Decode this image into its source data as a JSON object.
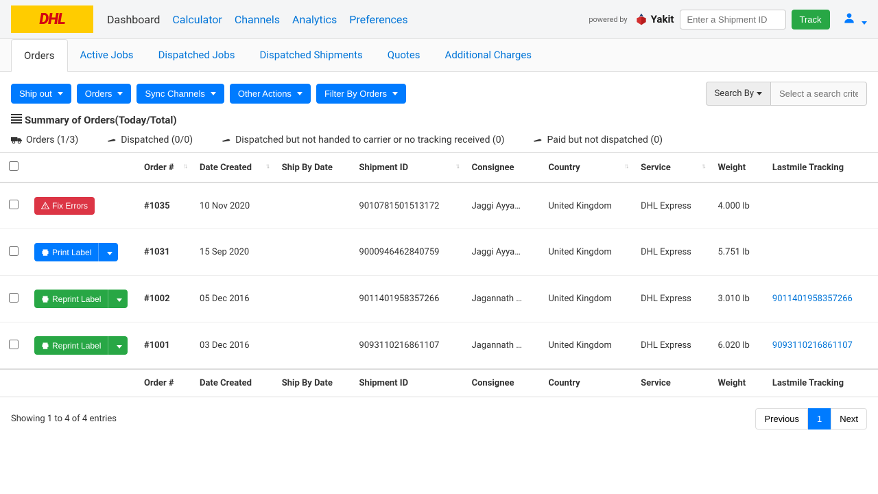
{
  "brand": "DHL",
  "nav": {
    "dashboard": "Dashboard",
    "calculator": "Calculator",
    "channels": "Channels",
    "analytics": "Analytics",
    "preferences": "Preferences"
  },
  "powered_by": "powered by",
  "partner": "Yakit",
  "shipment_input_placeholder": "Enter a Shipment ID",
  "track_btn": "Track",
  "tabs": {
    "orders": "Orders",
    "active_jobs": "Active Jobs",
    "dispatched_jobs": "Dispatched Jobs",
    "dispatched_shipments": "Dispatched Shipments",
    "quotes": "Quotes",
    "additional_charges": "Additional Charges"
  },
  "toolbar": {
    "ship_out": "Ship out",
    "orders": "Orders",
    "sync_channels": "Sync Channels",
    "other_actions": "Other Actions",
    "filter_by_orders": "Filter By Orders",
    "search_by": "Search By",
    "search_placeholder": "Select a search criteria"
  },
  "summary": {
    "title": "Summary of Orders(Today/Total)",
    "orders": "Orders (1/3)",
    "dispatched": "Dispatched (0/0)",
    "not_handed": "Dispatched but not handed to carrier or no tracking received (0)",
    "paid_not_dispatched": "Paid but not dispatched (0)"
  },
  "columns": {
    "order_no": "Order #",
    "date_created": "Date Created",
    "ship_by": "Ship By Date",
    "shipment_id": "Shipment ID",
    "consignee": "Consignee",
    "country": "Country",
    "service": "Service",
    "weight": "Weight",
    "lastmile": "Lastmile Tracking"
  },
  "actions": {
    "fix_errors": "Fix Errors",
    "print_label": "Print Label",
    "reprint_label": "Reprint Label"
  },
  "rows": [
    {
      "order": "#1035",
      "date": "10 Nov 2020",
      "shipby": "",
      "shipment": "9010781501513172",
      "consignee": "Jaggi Ayya…",
      "country": "United Kingdom",
      "service": "DHL Express",
      "weight": "4.000 lb",
      "tracking": ""
    },
    {
      "order": "#1031",
      "date": "15 Sep 2020",
      "shipby": "",
      "shipment": "9000946462840759",
      "consignee": "Jaggi Ayya…",
      "country": "United Kingdom",
      "service": "DHL Express",
      "weight": "5.751 lb",
      "tracking": ""
    },
    {
      "order": "#1002",
      "date": "05 Dec 2016",
      "shipby": "",
      "shipment": "9011401958357266",
      "consignee": "Jagannath …",
      "country": "United Kingdom",
      "service": "DHL Express",
      "weight": "3.010 lb",
      "tracking": "9011401958357266"
    },
    {
      "order": "#1001",
      "date": "03 Dec 2016",
      "shipby": "",
      "shipment": "9093110216861107",
      "consignee": "Jagannath …",
      "country": "United Kingdom",
      "service": "DHL Express",
      "weight": "6.020 lb",
      "tracking": "9093110216861107"
    }
  ],
  "footer": {
    "showing": "Showing 1 to 4 of 4 entries",
    "previous": "Previous",
    "page": "1",
    "next": "Next"
  }
}
